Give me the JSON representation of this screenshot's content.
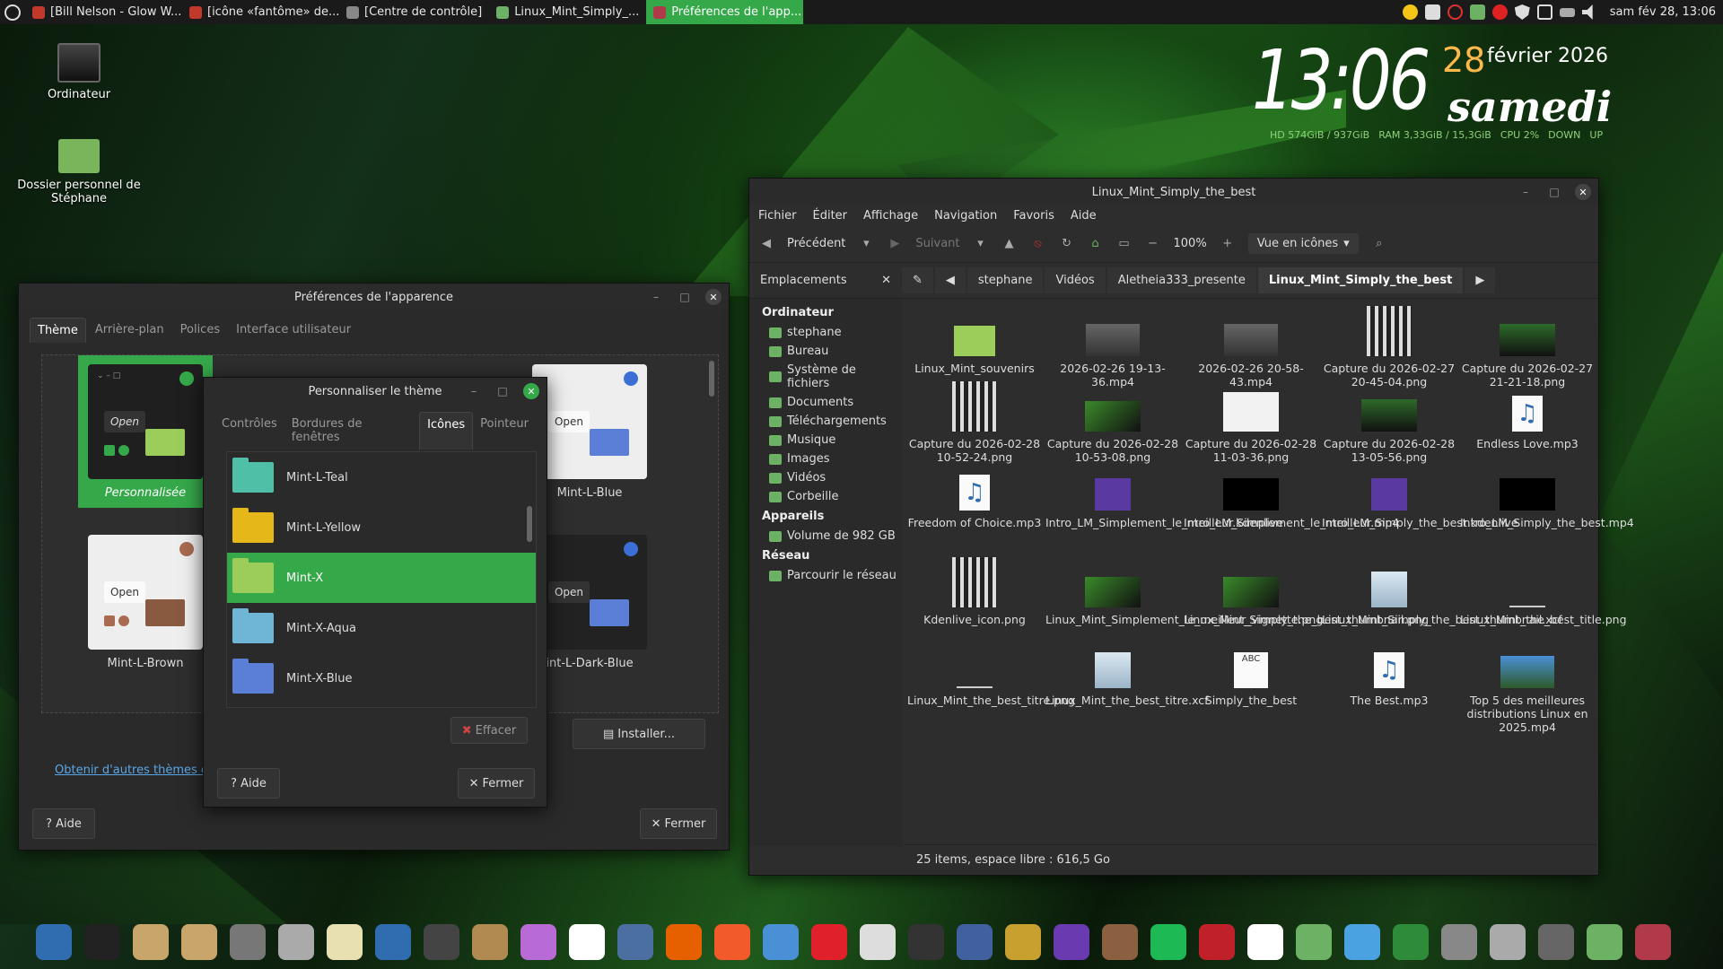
{
  "top_panel": {
    "tasks": [
      {
        "label": "[Bill Nelson - Glow W...",
        "color": "#c0392b",
        "active": false
      },
      {
        "label": "[icône «fantôme» de...",
        "color": "#c0392b",
        "active": false
      },
      {
        "label": "[Centre de contrôle]",
        "color": "#888888",
        "active": false
      },
      {
        "label": "Linux_Mint_Simply_...",
        "color": "#6db164",
        "active": false
      },
      {
        "label": "Préférences de l'app...",
        "color": "#b03a4a",
        "active": true
      }
    ],
    "clock": "sam fév 28, 13:06"
  },
  "desktop": {
    "icons": [
      {
        "label": "Ordinateur"
      },
      {
        "label": "Dossier personnel de Stéphane"
      }
    ]
  },
  "conky": {
    "time": "13:06",
    "day": "28",
    "month": "février 2026",
    "weekday": "samedi",
    "hd": "HD  574GiB  / 937GiB",
    "ram": "RAM  3,33GiB / 15,3GiB",
    "cpu": "CPU  2%",
    "down": "DOWN",
    "up": "UP"
  },
  "prefs": {
    "title": "Préférences de l'apparence",
    "tabs": [
      "Thème",
      "Arrière-plan",
      "Polices",
      "Interface utilisateur"
    ],
    "themes": [
      {
        "label": "Personnalisée",
        "open": "Open"
      },
      {
        "label": "Mint-L-Blue",
        "open": "Open"
      },
      {
        "label": "Mint-L-Brown",
        "open": "Open"
      },
      {
        "label": "int-L-Dark-Blue",
        "open": "Open"
      }
    ],
    "install": "Installer...",
    "link": "Obtenir d'autres thèmes en",
    "help": "Aide",
    "close": "Fermer"
  },
  "custom": {
    "title": "Personnaliser le thème",
    "tabs": [
      "Contrôles",
      "Bordures de fenêtres",
      "Icônes",
      "Pointeur"
    ],
    "icons": [
      {
        "label": "Mint-L-Teal",
        "color": "#4fbfa8"
      },
      {
        "label": "Mint-L-Yellow",
        "color": "#e5b718"
      },
      {
        "label": "Mint-X",
        "color": "#9ccc5a"
      },
      {
        "label": "Mint-X-Aqua",
        "color": "#6fb6d6"
      },
      {
        "label": "Mint-X-Blue",
        "color": "#5b7fd6"
      }
    ],
    "clear": "Effacer",
    "help": "Aide",
    "close": "Fermer"
  },
  "nemo": {
    "title": "Linux_Mint_Simply_the_best",
    "menu": [
      "Fichier",
      "Éditer",
      "Affichage",
      "Navigation",
      "Favoris",
      "Aide"
    ],
    "prev": "Précédent",
    "next": "Suivant",
    "zoom": "100%",
    "view": "Vue en icônes",
    "places": "Emplacements",
    "crumbs": [
      "stephane",
      "Vidéos",
      "Aletheia333_presente",
      "Linux_Mint_Simply_the_best"
    ],
    "sidebar": {
      "computer": "Ordinateur",
      "computer_items": [
        "stephane",
        "Bureau",
        "Système de fichiers",
        "Documents",
        "Téléchargements",
        "Musique",
        "Images",
        "Vidéos",
        "Corbeille"
      ],
      "devices": "Appareils",
      "device_items": [
        "Volume de 982 GB"
      ],
      "network": "Réseau",
      "network_items": [
        "Parcourir le réseau"
      ]
    },
    "files": [
      {
        "name": "Linux_Mint_souvenirs",
        "kind": "folder"
      },
      {
        "name": "2026-02-26 19-13-36.mp4",
        "kind": "video"
      },
      {
        "name": "2026-02-26 20-58-43.mp4",
        "kind": "video"
      },
      {
        "name": "Capture du 2026-02-27 20-45-04.png",
        "kind": "png-grid"
      },
      {
        "name": "Capture du 2026-02-27 21-21-18.png",
        "kind": "png-dark"
      },
      {
        "name": "Capture du 2026-02-28 10-52-24.png",
        "kind": "png-grid"
      },
      {
        "name": "Capture du 2026-02-28 10-53-08.png",
        "kind": "png-green"
      },
      {
        "name": "Capture du 2026-02-28 11-03-36.png",
        "kind": "png-light"
      },
      {
        "name": "Capture du 2026-02-28 13-05-56.png",
        "kind": "png-dark"
      },
      {
        "name": "Endless Love.mp3",
        "kind": "mp3"
      },
      {
        "name": "Freedom of Choice.mp3",
        "kind": "mp3"
      },
      {
        "name": "Intro_LM_Simplement_le_meilleur.kdenlive",
        "kind": "kdenlive"
      },
      {
        "name": "Intro_LM_Simplement_le_meilleur.mp4",
        "kind": "black"
      },
      {
        "name": "Intro_LM_Simply_the_best.kdenlive",
        "kind": "kdenlive"
      },
      {
        "name": "Intro_LM_Simply_the_best.mp4",
        "kind": "black"
      },
      {
        "name": "Kdenlive_icon.png",
        "kind": "png-grid"
      },
      {
        "name": "Linux_Mint_Simplement_le_meilleur_vignette.png",
        "kind": "png-green"
      },
      {
        "name": "Linux_Mint_Simply_the_best_thumbnail.png",
        "kind": "png-green"
      },
      {
        "name": "Linux_Mint_Simply_the_best_thumbnail.xcf",
        "kind": "xcf"
      },
      {
        "name": "Linux_Mint_the_best_title.png",
        "kind": "title"
      },
      {
        "name": "Linux_Mint_the_best_titre.png",
        "kind": "title"
      },
      {
        "name": "Linux_Mint_the_best_titre.xcf",
        "kind": "xcf"
      },
      {
        "name": "Simply_the_best",
        "kind": "text"
      },
      {
        "name": "The Best.mp3",
        "kind": "mp3"
      },
      {
        "name": "Top 5 des meilleures distributions Linux en 2025.mp4",
        "kind": "video-land"
      }
    ],
    "status": "25 items, espace libre : 616,5 Go"
  },
  "dock": {
    "colors": [
      "#2f6db0",
      "#222222",
      "#c8a56a",
      "#c8a56a",
      "#777777",
      "#aaaaaa",
      "#e8e0b0",
      "#2f6db0",
      "#444444",
      "#b08a50",
      "#b86bd6",
      "#ffffff",
      "#4a6fa0",
      "#e66000",
      "#f25a2a",
      "#4a90d6",
      "#e0202a",
      "#dddddd",
      "#333333",
      "#4060a0",
      "#c8a030",
      "#6a3ab0",
      "#8a6040",
      "#1db954",
      "#c0202a",
      "#ffffff",
      "#6db164",
      "#4aa3e0",
      "#2e8b3a",
      "#888888",
      "#aaaaaa",
      "#666666",
      "#6db164",
      "#b03a4a"
    ]
  }
}
